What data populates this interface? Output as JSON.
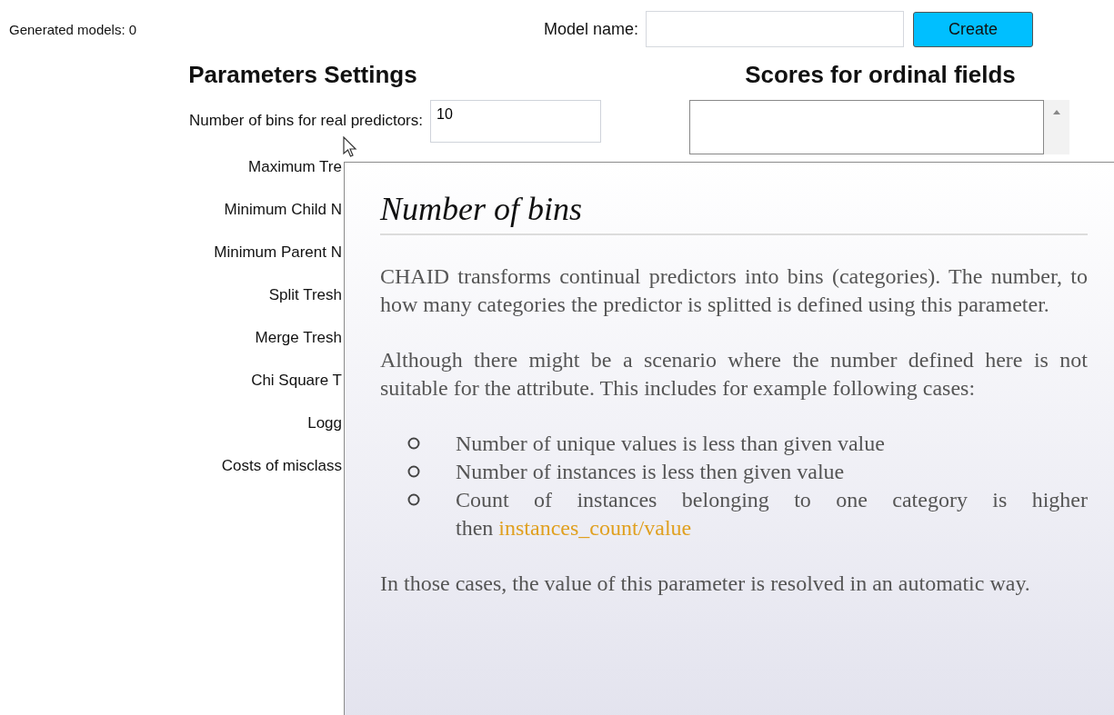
{
  "status": {
    "label": "Generated models: 0"
  },
  "model_name": {
    "label": "Model name:"
  },
  "create_button": {
    "label": "Create"
  },
  "parameters": {
    "heading": "Parameters Settings",
    "rows": [
      {
        "label": "Number of bins for real predictors:",
        "value": "10"
      },
      {
        "label": "Maximum Tre"
      },
      {
        "label": "Minimum Child N"
      },
      {
        "label": "Minimum Parent N"
      },
      {
        "label": "Split Tresh"
      },
      {
        "label": "Merge Tresh"
      },
      {
        "label": "Chi Square T"
      },
      {
        "label": "Logg"
      },
      {
        "label": "Costs of misclass"
      }
    ]
  },
  "scores": {
    "heading": "Scores for ordinal fields"
  },
  "tooltip": {
    "title": "Number of bins",
    "paragraphs": [
      "CHAID transforms continual predictors into bins (categories). The number, to how many categories the predictor is splitted is defined using this parameter.",
      "Although there might be a scenario where the number defined here is not suitable for the attribute. This includes for example following cases:"
    ],
    "bullets": [
      {
        "text": "Number of unique values is less than given value"
      },
      {
        "text": "Number of instances is less then given value"
      },
      {
        "text": "Count of instances belonging to one category is higher then",
        "highlight": "instances_count/value"
      }
    ],
    "closing": "In those cases, the value of this parameter is resolved in an automatic way."
  }
}
